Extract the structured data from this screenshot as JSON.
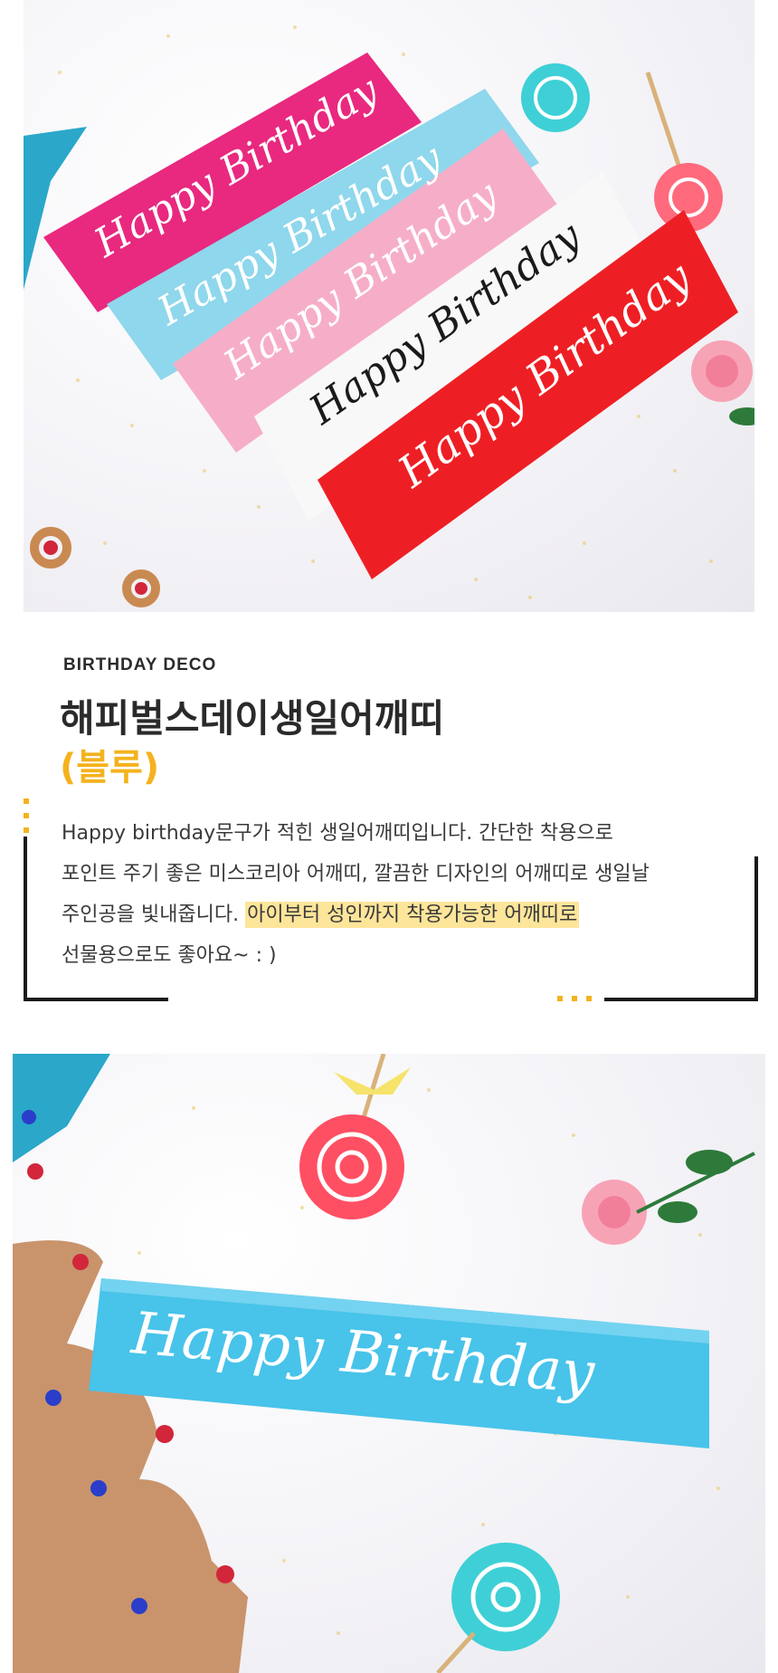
{
  "section": {
    "eyebrow": "BIRTHDAY DECO",
    "title": "해피벌스데이생일어깨띠",
    "subtitle": "(블루)",
    "description_lines": [
      "Happy birthday문구가 적힌 생일어깨띠입니다. 간단한 착용으로",
      "포인트 주기 좋은 미스코리아 어깨띠, 깔끔한 디자인의 어깨띠로 생일날",
      "주인공을 빛내줍니다.",
      "아이부터 성인까지 착용가능한 어깨띠로",
      "선물용으로도 좋아요~ : )"
    ]
  },
  "photos": {
    "top_sash_text": "Happy Birthday",
    "bottom_sash_text": "Happy Birthday"
  },
  "colors": {
    "accent": "#f4b21d",
    "highlight": "#fde59a",
    "text": "#3a3a3a",
    "title": "#2a2a2a"
  }
}
